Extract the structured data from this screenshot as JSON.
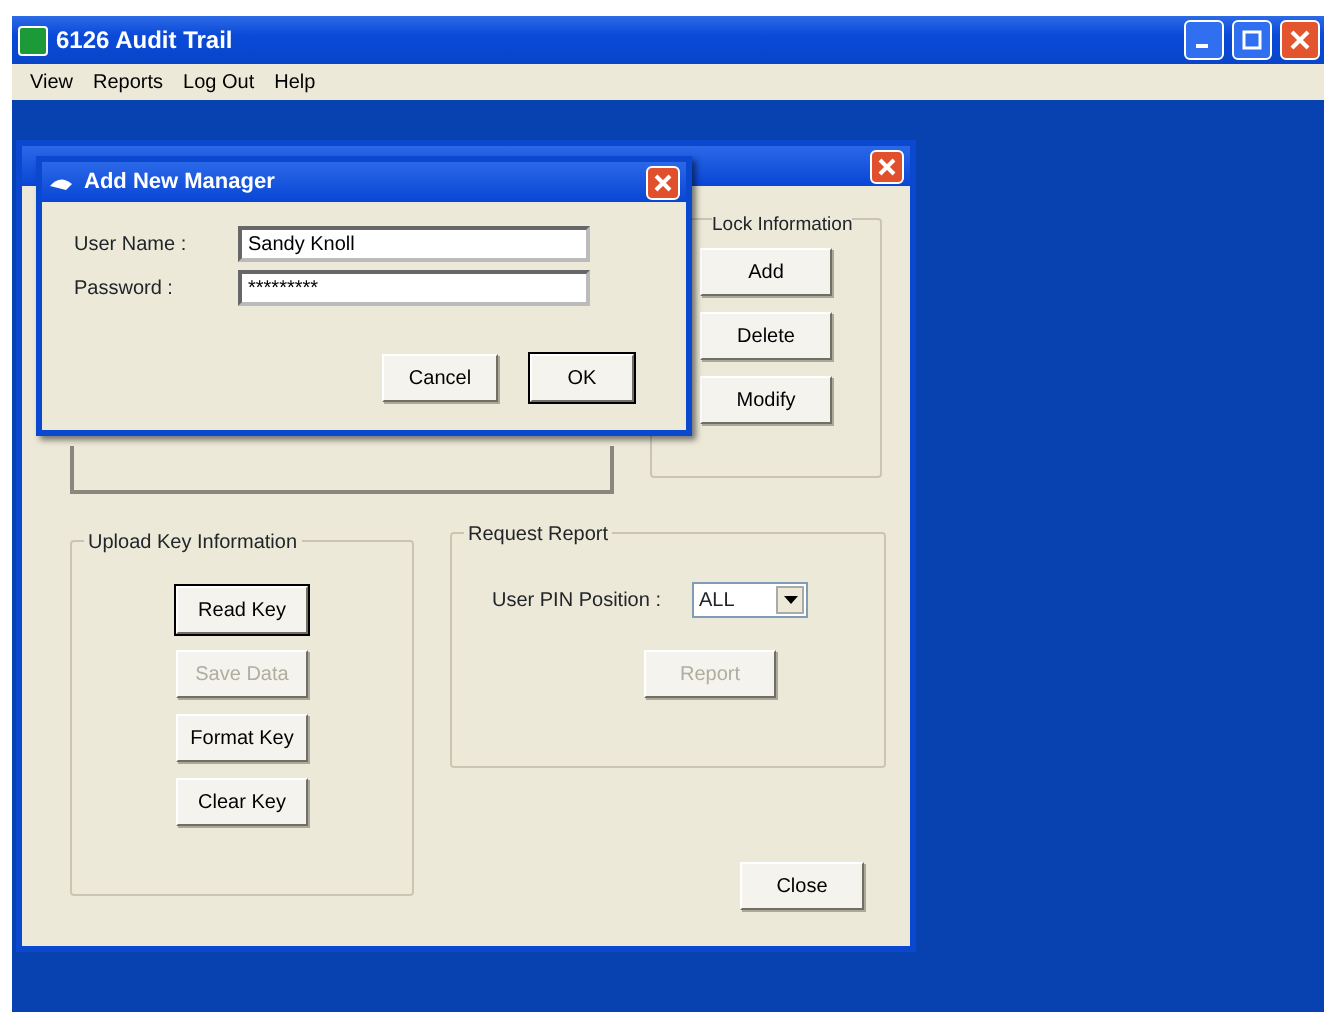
{
  "window": {
    "title": "6126 Audit Trail"
  },
  "menu": [
    "View",
    "Reports",
    "Log Out",
    "Help"
  ],
  "main_dialog": {
    "lock_information": {
      "title": "Lock Information",
      "buttons": [
        {
          "label": "Add",
          "disabled": false,
          "default": false
        },
        {
          "label": "Delete",
          "disabled": false,
          "default": false
        },
        {
          "label": "Modify",
          "disabled": false,
          "default": false
        }
      ]
    },
    "upload_key_information": {
      "title": "Upload Key Information",
      "buttons": [
        {
          "label": "Read Key",
          "disabled": false,
          "default": true
        },
        {
          "label": "Save Data",
          "disabled": true,
          "default": false
        },
        {
          "label": "Format Key",
          "disabled": false,
          "default": false
        },
        {
          "label": "Clear Key",
          "disabled": false,
          "default": false
        }
      ]
    },
    "request_report": {
      "title": "Request Report",
      "pin_label": "User PIN Position :",
      "pin_value": "ALL",
      "button": {
        "label": "Report",
        "disabled": true,
        "default": false
      }
    },
    "close_button": {
      "label": "Close",
      "disabled": false,
      "default": false
    }
  },
  "add_manager_dialog": {
    "title": "Add New Manager",
    "fields": [
      {
        "label": "User Name :",
        "value": "Sandy Knoll"
      },
      {
        "label": "Password :",
        "value": "*********"
      }
    ],
    "buttons": [
      {
        "label": "Cancel",
        "disabled": false,
        "default": false
      },
      {
        "label": "OK",
        "disabled": false,
        "default": true
      }
    ]
  }
}
